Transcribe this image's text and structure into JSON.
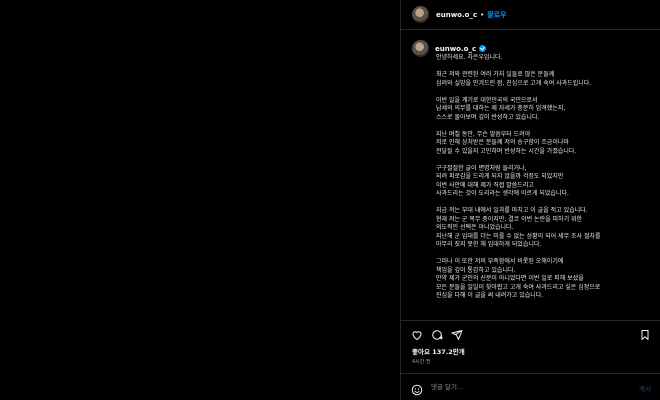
{
  "header": {
    "username": "eunwo.o_c",
    "separator": "•",
    "follow_label": "팔로우"
  },
  "caption": {
    "username": "eunwo.o_c",
    "paragraphs": [
      "안녕하세요. 차은우입니다.",
      "최근 저와 관련된 여러 가지 일들로 많은 분들께\n심려와 실망을 안겨드린 점, 진심으로 고개 숙여 사과드립니다.",
      "이번 일을 계기로 대한민국의 국민으로서\n납세의 의무를 대하는 제 자세가 충분히 엄격했는지,\n스스로 돌아보며 깊이 반성하고 있습니다.",
      "지난 며칠 동안, 무슨 말씀부터 드려야\n저로 인해 상처받은 분들께 저의 송구함이 조금이나마\n전달될 수 있을지 고민하며 반성하는 시간을 가졌습니다.",
      "구구절절한 글이 변명처럼 들리거나,\n되려 피로감을 드리게 되지 않을까 걱정도 되었지만\n이번 사안에 대해 제가 직접 말씀드리고\n사과드리는 것이 도리라는 생각에 이르게 되었습니다.",
      "지금 저는 부대 내에서 일과를 마치고 이 글을 적고 있습니다.\n현재 저는 군 복무 중이지만, 결코 이번 논란을 피하기 위한\n의도적인 선택은 아니었습니다.\n지난해 군 입대를 더는 미룰 수 없는 상황이 되어 세무 조사 절차를\n마무리 짓지 못한 채 입대하게 되었습니다.",
      "그러나 이 또한 저의 부족함에서 비롯된 오해이기에\n책임을 깊이 통감하고 있습니다.\n만약 제가 군인의 신분이 아니었다면 이번 일로 피해 보셨을\n모든 분들을 일일이 찾아뵙고 고개 숙여 사과드리고 싶은 심정으로\n진심을 다해 이 글을 써 내려가고 있습니다."
    ]
  },
  "actions": {
    "like_icon": "heart-icon",
    "comment_icon": "comment-icon",
    "share_icon": "share-icon",
    "save_icon": "bookmark-icon"
  },
  "likes_text": "좋아요 137.2만개",
  "time_text": "4시간 전",
  "comment_box": {
    "emoji_icon": "emoji-icon",
    "placeholder": "댓글 달기...",
    "post_label": "게시"
  },
  "colors": {
    "background": "#000000",
    "text": "#f5f5f5",
    "secondary_text": "#a8a8a8",
    "link_blue": "#0095f6",
    "divider": "#262626"
  }
}
